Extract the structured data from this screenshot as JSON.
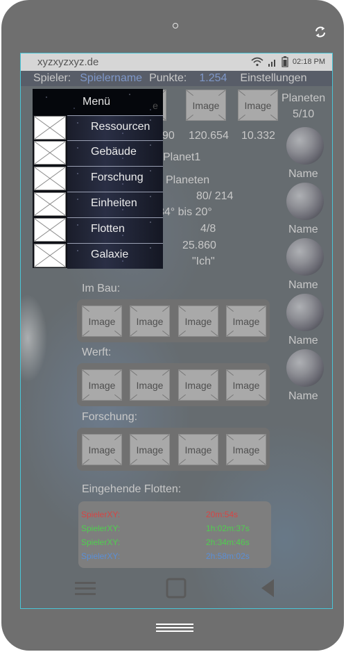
{
  "browser": {
    "url": "xyzxyzxyz.de",
    "time": "02:18 PM"
  },
  "infobar": {
    "player_label": "Spieler:",
    "player_name": "Spielername",
    "points_label": "Punkte:",
    "points_value": "1.254",
    "settings_label": "Einstellungen"
  },
  "resources": {
    "image_label": "Image",
    "partial_image_label": "e",
    "partial_value": "90",
    "value_2": "120.654",
    "value_3": "10.332"
  },
  "planet_info": {
    "planet_name": "Planet1",
    "heading": "Planeten",
    "fields": "80/ 214",
    "temperature": "34° bis 20°",
    "slots": "4/8",
    "score": "25.860",
    "owner": "\"Ich\""
  },
  "sidebar": {
    "title": "Planeten",
    "count": "5/10",
    "planets": [
      {
        "name": "Name"
      },
      {
        "name": "Name"
      },
      {
        "name": "Name"
      },
      {
        "name": "Name"
      },
      {
        "name": "Name"
      }
    ]
  },
  "sections": {
    "construction": "Im Bau:",
    "shipyard": "Werft:",
    "research": "Forschung:",
    "incoming": "Eingehende Flotten:"
  },
  "fleets": [
    {
      "player": "SpielerXY:",
      "time": "20m:54s",
      "color": "#d64545"
    },
    {
      "player": "SpielerXY:",
      "time": "1h:02m:37s",
      "color": "#4fcf4f"
    },
    {
      "player": "SpielerXY:",
      "time": "2h:34m:46s",
      "color": "#4fcf4f"
    },
    {
      "player": "SpielerXY:",
      "time": "2h:58m:02s",
      "color": "#5b8fd6"
    }
  ],
  "menu": {
    "title": "Menü",
    "items": [
      {
        "label": "Ressourcen"
      },
      {
        "label": "Gebäude"
      },
      {
        "label": "Forschung"
      },
      {
        "label": "Einheiten"
      },
      {
        "label": "Flotten"
      },
      {
        "label": "Galaxie"
      }
    ]
  }
}
